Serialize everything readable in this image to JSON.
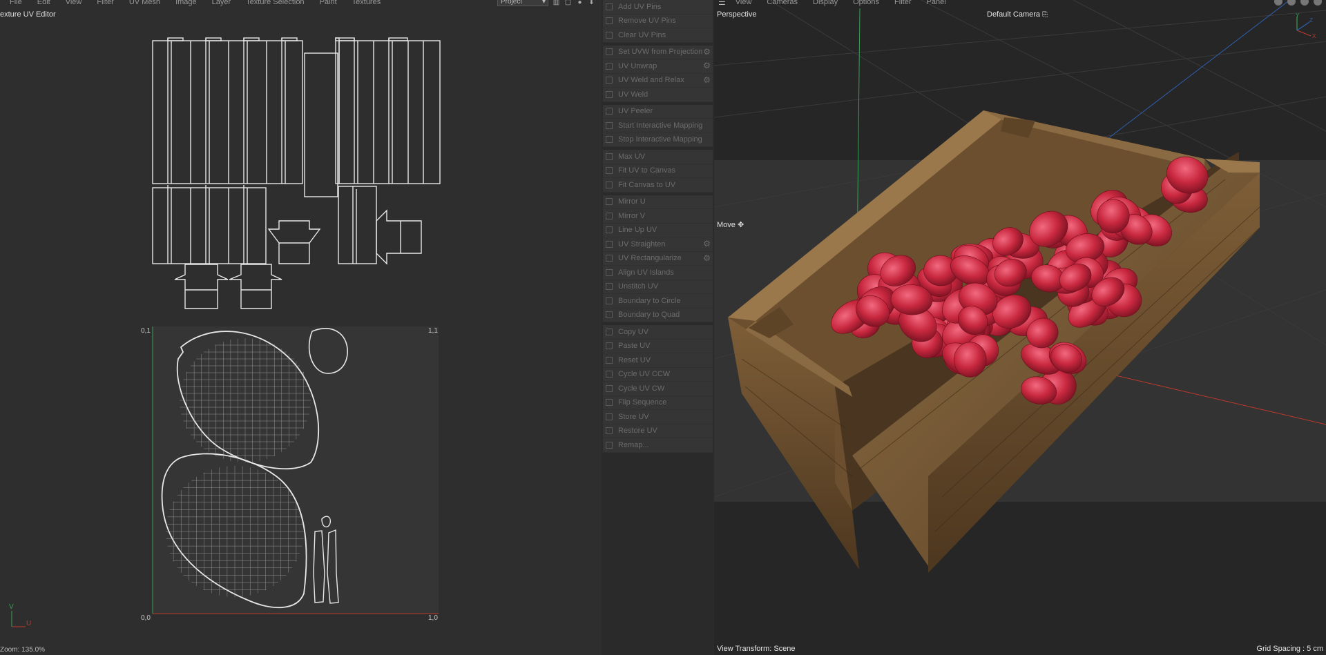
{
  "uv_editor": {
    "menu": [
      "File",
      "Edit",
      "View",
      "Filter",
      "UV Mesh",
      "Image",
      "Layer",
      "Texture Selection",
      "Paint",
      "Textures"
    ],
    "title": "exture UV Editor",
    "project_select": "Project",
    "coords": {
      "top_left": "0,1",
      "top_right": "1,1",
      "bottom_left": "0,0",
      "bottom_right": "1,0"
    },
    "axis_u": "U",
    "axis_v": "V",
    "zoom": "Zoom: 135.0%"
  },
  "uv_commands": {
    "groups": [
      {
        "items": [
          {
            "label": "Add UV Pins",
            "icon": "pin-icon",
            "gear": false
          },
          {
            "label": "Remove UV Pins",
            "icon": "pin-remove-icon",
            "gear": false
          },
          {
            "label": "Clear UV Pins",
            "icon": "close-icon",
            "gear": false
          }
        ]
      },
      {
        "items": [
          {
            "label": "Set UVW from Projection",
            "icon": "projection-icon",
            "gear": true
          },
          {
            "label": "UV Unwrap",
            "icon": "unwrap-icon",
            "gear": true
          },
          {
            "label": "UV Weld and Relax",
            "icon": "weld-relax-icon",
            "gear": true
          },
          {
            "label": "UV Weld",
            "icon": "weld-icon",
            "gear": false
          }
        ]
      },
      {
        "items": [
          {
            "label": "UV Peeler",
            "icon": "peeler-icon",
            "gear": false
          },
          {
            "label": "Start Interactive Mapping",
            "icon": "play-icon",
            "gear": false
          },
          {
            "label": "Stop Interactive Mapping",
            "icon": "stop-icon",
            "gear": false
          }
        ]
      },
      {
        "items": [
          {
            "label": "Max UV",
            "icon": "max-uv-icon",
            "gear": false
          },
          {
            "label": "Fit UV to Canvas",
            "icon": "fit-uv-icon",
            "gear": false
          },
          {
            "label": "Fit Canvas to UV",
            "icon": "fit-canvas-icon",
            "gear": false
          }
        ]
      },
      {
        "items": [
          {
            "label": "Mirror U",
            "icon": "mirror-u-icon",
            "gear": false
          },
          {
            "label": "Mirror V",
            "icon": "mirror-v-icon",
            "gear": false
          },
          {
            "label": "Line Up UV",
            "icon": "line-up-icon",
            "gear": false
          },
          {
            "label": "UV Straighten",
            "icon": "straighten-icon",
            "gear": true
          },
          {
            "label": "UV Rectangularize",
            "icon": "rectangularize-icon",
            "gear": true
          },
          {
            "label": "Align UV Islands",
            "icon": "align-icon",
            "gear": false
          },
          {
            "label": "Unstitch UV",
            "icon": "unstitch-icon",
            "gear": false
          },
          {
            "label": "Boundary to Circle",
            "icon": "circle-icon",
            "gear": false
          },
          {
            "label": "Boundary to Quad",
            "icon": "quad-icon",
            "gear": false
          }
        ]
      },
      {
        "items": [
          {
            "label": "Copy UV",
            "icon": "copy-icon",
            "gear": false
          },
          {
            "label": "Paste UV",
            "icon": "paste-icon",
            "gear": false
          },
          {
            "label": "Reset UV",
            "icon": "reset-icon",
            "gear": false
          },
          {
            "label": "Cycle UV CCW",
            "icon": "cycle-ccw-icon",
            "gear": false
          },
          {
            "label": "Cycle UV CW",
            "icon": "cycle-cw-icon",
            "gear": false
          },
          {
            "label": "Flip Sequence",
            "icon": "flip-icon",
            "gear": false
          },
          {
            "label": "Store UV",
            "icon": "store-icon",
            "gear": false
          },
          {
            "label": "Restore UV",
            "icon": "restore-icon",
            "gear": false
          },
          {
            "label": "Remap...",
            "icon": "remap-icon",
            "gear": false
          }
        ]
      }
    ]
  },
  "viewport": {
    "menu": [
      "View",
      "Cameras",
      "Display",
      "Options",
      "Filter",
      "Panel"
    ],
    "label": "Perspective",
    "camera": "Default Camera",
    "move_label": "Move",
    "view_transform": "View Transform: Scene",
    "grid_spacing": "Grid Spacing : 5 cm",
    "gizmo": {
      "y": "Y",
      "z": "Z",
      "x": "X"
    }
  },
  "colors": {
    "fruit": "#c8283f",
    "crate": "#7a5a36",
    "axis_x": "#c0392b",
    "axis_y": "#3aa055",
    "axis_z": "#2f5fb0"
  }
}
